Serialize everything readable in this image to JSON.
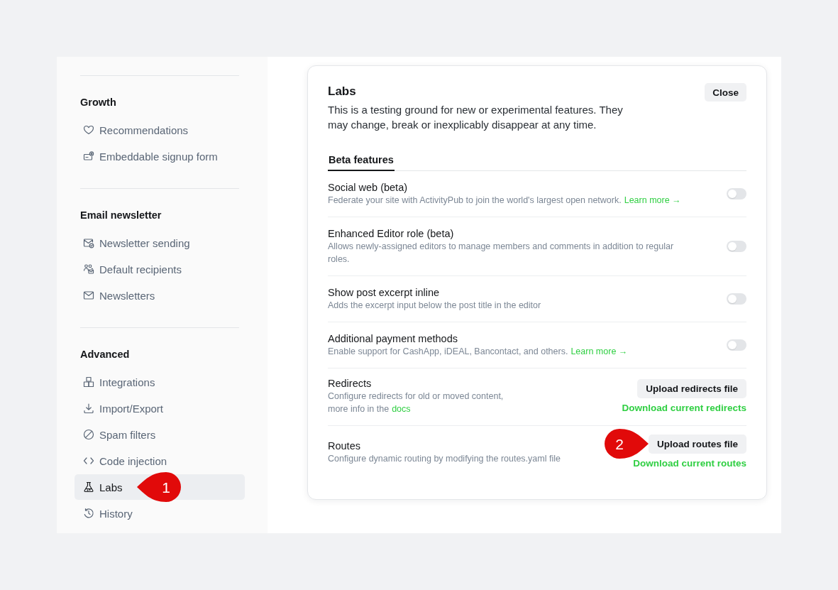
{
  "sidebar": {
    "sections": [
      {
        "heading": "Growth",
        "items": [
          {
            "label": "Recommendations",
            "selected": false
          },
          {
            "label": "Embeddable signup form",
            "selected": false
          }
        ]
      },
      {
        "heading": "Email newsletter",
        "items": [
          {
            "label": "Newsletter sending",
            "selected": false
          },
          {
            "label": "Default recipients",
            "selected": false
          },
          {
            "label": "Newsletters",
            "selected": false
          }
        ]
      },
      {
        "heading": "Advanced",
        "items": [
          {
            "label": "Integrations",
            "selected": false
          },
          {
            "label": "Import/Export",
            "selected": false
          },
          {
            "label": "Spam filters",
            "selected": false
          },
          {
            "label": "Code injection",
            "selected": false
          },
          {
            "label": "Labs",
            "selected": true,
            "callout": "1"
          },
          {
            "label": "History",
            "selected": false
          }
        ]
      }
    ]
  },
  "labs": {
    "title": "Labs",
    "close_button": "Close",
    "description": "This is a testing ground for new or experimental features. They may change, break or inexplicably disappear at any time.",
    "tabs": [
      {
        "label": "Beta features",
        "selected": true
      }
    ],
    "features": [
      {
        "kind": "toggle",
        "title": "Social web (beta)",
        "description": "Federate your site with ActivityPub to join the world's largest open network.",
        "link": "Learn more →",
        "on": false
      },
      {
        "kind": "toggle",
        "title": "Enhanced Editor role (beta)",
        "description": "Allows newly-assigned editors to manage members and comments in addition to regular roles.",
        "on": false
      },
      {
        "kind": "toggle",
        "title": "Show post excerpt inline",
        "description": "Adds the excerpt input below the post title in the editor",
        "on": false
      },
      {
        "kind": "toggle",
        "title": "Additional payment methods",
        "description": "Enable support for CashApp, iDEAL, Bancontact, and others.",
        "link": "Learn more →",
        "on": false
      },
      {
        "kind": "upload",
        "title": "Redirects",
        "description": "Configure redirects for old or moved content,\nmore info in the",
        "link": "docs",
        "button": "Upload redirects file",
        "download": "Download current redirects"
      },
      {
        "kind": "upload",
        "title": "Routes",
        "description": "Configure dynamic routing by modifying the routes.yaml file",
        "button": "Upload routes file",
        "download": "Download current routes",
        "callout": "2"
      }
    ]
  }
}
